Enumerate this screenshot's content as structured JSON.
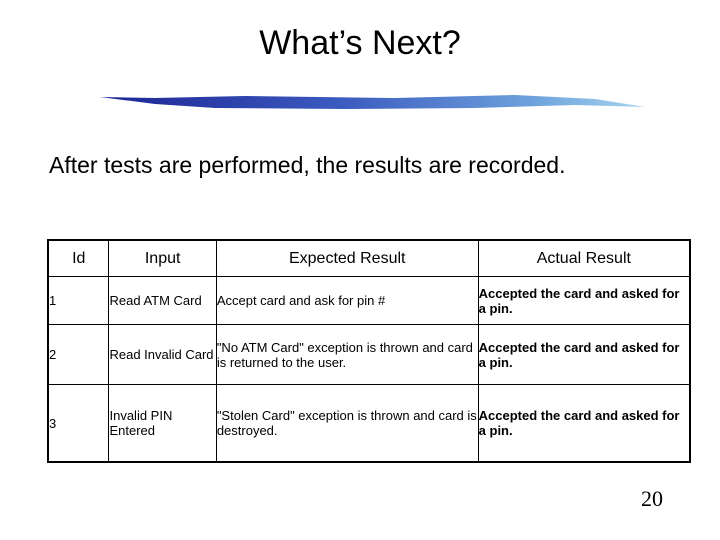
{
  "slide": {
    "title": "What’s Next?",
    "intro": "After tests are performed, the results are recorded.",
    "page_number": "20",
    "accent_colors": {
      "brush_dark": "#1f2a9e",
      "brush_mid": "#4a6fc8",
      "brush_light": "#8ec5e8"
    }
  },
  "table": {
    "headers": [
      "Id",
      "Input",
      "Expected Result",
      "Actual Result"
    ],
    "rows": [
      {
        "id": "1",
        "input": "Read ATM Card",
        "expected": "Accept card and ask for pin #",
        "actual": "Accepted the card and asked for a pin."
      },
      {
        "id": "2",
        "input": "Read Invalid Card",
        "expected": "\"No ATM Card\" exception is thrown and card is returned to the user.",
        "actual": "Accepted the card and asked for a pin."
      },
      {
        "id": "3",
        "input": "Invalid PIN Entered",
        "expected": "\"Stolen Card\" exception is thrown and card is destroyed.",
        "actual": "Accepted the card and asked for a pin."
      }
    ]
  }
}
